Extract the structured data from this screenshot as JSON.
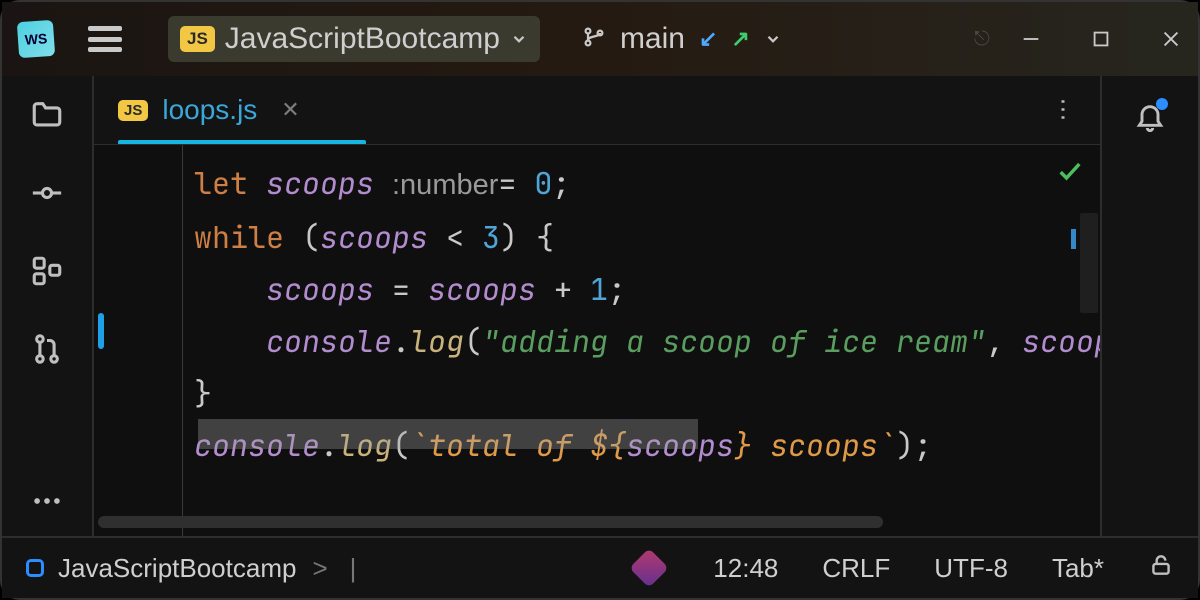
{
  "app": {
    "icon_label": "WS"
  },
  "titlebar": {
    "project_name": "JavaScriptBootcamp",
    "branch_name": "main",
    "js_chip": "JS"
  },
  "sidebar_left": {
    "items": [
      {
        "id": "folder-icon"
      },
      {
        "id": "commit-icon"
      },
      {
        "id": "structure-icon"
      },
      {
        "id": "vcs-branches-icon"
      },
      {
        "id": "more-icon"
      }
    ]
  },
  "tab": {
    "chip": "JS",
    "filename": "loops.js"
  },
  "code": {
    "line1": {
      "kw": "let",
      "ident": "scoops",
      "type_hint": ":number",
      "eq": "=",
      "num": "0",
      "semi": ";"
    },
    "line2": {
      "kw": "while",
      "open": "(",
      "ident": "scoops",
      "op": "<",
      "num": "3",
      "close": ")",
      "brace": "{"
    },
    "line3": {
      "ident": "scoops",
      "eq": "=",
      "ident2": "scoops",
      "op": "+",
      "num": "1",
      "semi": ";"
    },
    "line4": {
      "obj": "console",
      "dot": ".",
      "method": "log",
      "open": "(",
      "str": "\"adding a scoop of ice ream\"",
      "comma": ",",
      "ident": "scoop"
    },
    "line5": {
      "brace": "}"
    },
    "line6": {
      "obj": "console",
      "dot": ".",
      "method": "log",
      "open": "(",
      "tmpl_a": "`total of ${",
      "ident": "scoops",
      "tmpl_b": "} scoops`",
      "close": ")",
      "semi": ";"
    }
  },
  "statusbar": {
    "breadcrumb_root": "JavaScriptBootcamp",
    "breadcrumb_sep": ">",
    "caret_pos": "12:48",
    "line_sep": "CRLF",
    "encoding": "UTF-8",
    "indent": "Tab*"
  },
  "colors": {
    "accent": "#17b6e0",
    "notification": "#2d8cff"
  }
}
